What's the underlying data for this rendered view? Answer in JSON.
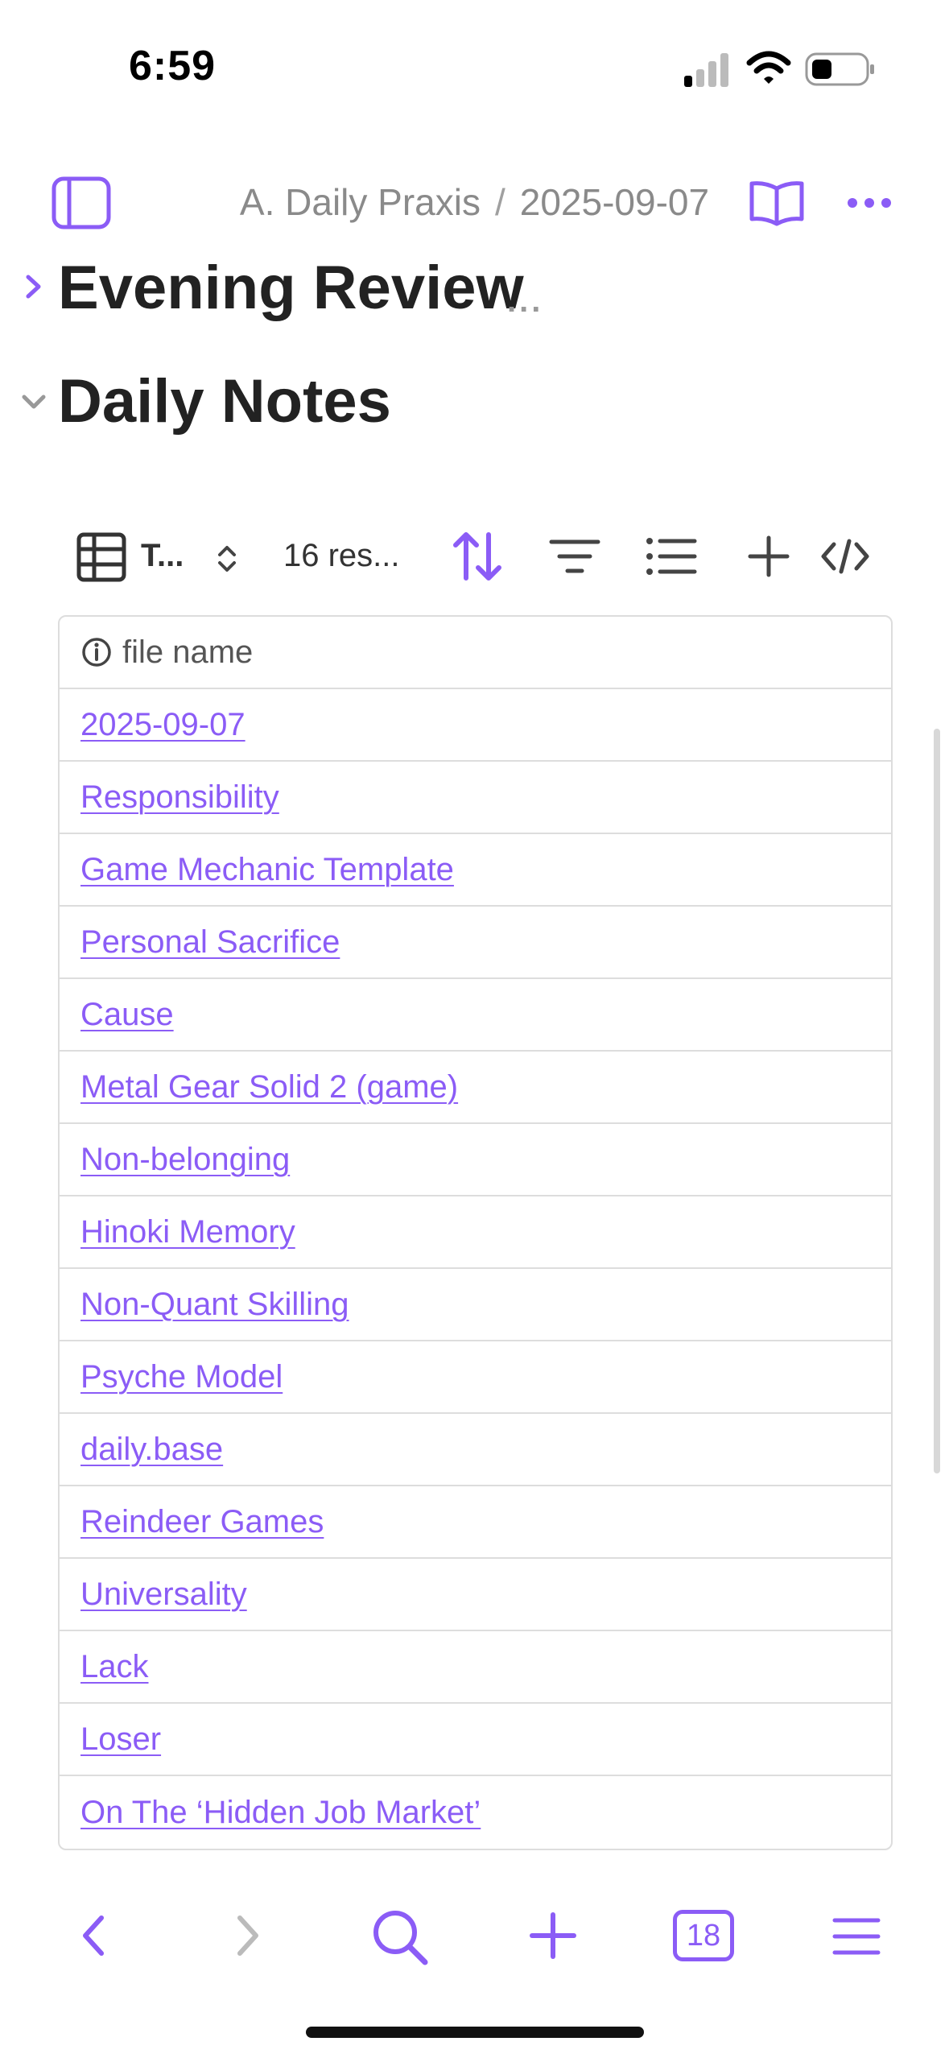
{
  "status_bar": {
    "time": "6:59"
  },
  "nav": {
    "breadcrumb_parent": "A. Daily Praxis",
    "breadcrumb_separator": "/",
    "breadcrumb_current": "2025-09-07"
  },
  "sections": {
    "evening_review": "Evening Review",
    "evening_review_more": "...",
    "daily_notes": "Daily Notes"
  },
  "base_toolbar": {
    "view_label": "T...",
    "results_label": "16 res..."
  },
  "table": {
    "header": "file name",
    "rows": [
      "2025-09-07",
      "Responsibility",
      "Game Mechanic Template",
      "Personal Sacrifice",
      "Cause",
      "Metal Gear Solid 2 (game)",
      "Non-belonging",
      "Hinoki Memory",
      "Non-Quant Skilling",
      "Psyche Model",
      "daily.base",
      "Reindeer Games",
      "Universality",
      "Lack",
      "Loser",
      "On The ‘Hidden Job Market’"
    ]
  },
  "bottom_bar": {
    "tabs_count": "18"
  },
  "colors": {
    "accent": "#8b5cf6",
    "text": "#222222",
    "muted": "#8a8a8a",
    "border": "#dddddd"
  }
}
